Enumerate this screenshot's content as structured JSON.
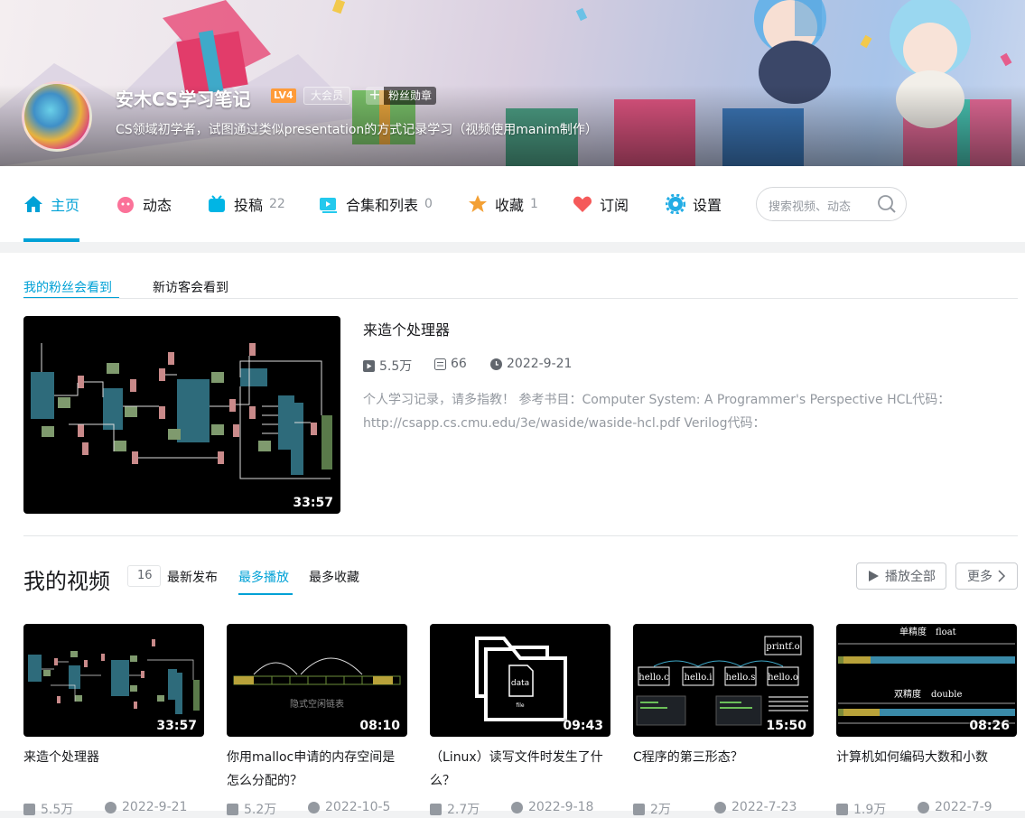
{
  "header": {
    "username": "安木CS学习笔记",
    "level": "LV4",
    "vip_label": "大会员",
    "fan_badge_plus": "+",
    "fan_badge_label": "粉丝勋章",
    "signature": "CS领域初学者，试图通过类似presentation的方式记录学习（视频使用manim制作）"
  },
  "nav": {
    "items": [
      {
        "label": "主页",
        "count": "",
        "icon": "home-icon",
        "color": "#00a1d6"
      },
      {
        "label": "动态",
        "count": "",
        "icon": "dynamic-icon",
        "color": "#fb7299"
      },
      {
        "label": "投稿",
        "count": "22",
        "icon": "upload-icon",
        "color": "#00b5e5"
      },
      {
        "label": "合集和列表",
        "count": "0",
        "icon": "collection-icon",
        "color": "#23c9ed"
      },
      {
        "label": "收藏",
        "count": "1",
        "icon": "favorite-icon",
        "color": "#f3a034"
      },
      {
        "label": "订阅",
        "count": "",
        "icon": "subscribe-icon",
        "color": "#f55a5a"
      },
      {
        "label": "设置",
        "count": "",
        "icon": "settings-icon",
        "color": "#23ade5"
      }
    ],
    "search_placeholder": "搜索视频、动态"
  },
  "visibility_tabs": [
    "我的粉丝会看到",
    "新访客会看到"
  ],
  "featured": {
    "title": "来造个处理器",
    "duration": "33:57",
    "plays": "5.5万",
    "comments": "66",
    "date": "2022-9-21",
    "description": "个人学习记录，请多指教！ 参考书目：Computer System: A Programmer's Perspective HCL代码：http://csapp.cs.cmu.edu/3e/waside/waside-hcl.pdf Verilog代码："
  },
  "videos_section": {
    "title": "我的视频",
    "count": "16",
    "sort_tabs": [
      "最新发布",
      "最多播放",
      "最多收藏"
    ],
    "active_sort": 1,
    "play_all_label": "播放全部",
    "more_label": "更多"
  },
  "videos": [
    {
      "title": "来造个处理器",
      "duration": "33:57",
      "plays": "5.5万",
      "date": "2022-9-21"
    },
    {
      "title": "你用malloc申请的内存空间是怎么分配的？",
      "duration": "08:10",
      "plays": "5.2万",
      "date": "2022-10-5",
      "thumb_text": "隐式空闲链表"
    },
    {
      "title": "（Linux）读写文件时发生了什么？",
      "duration": "09:43",
      "plays": "2.7万",
      "date": "2022-9-18",
      "thumb_text": "data",
      "thumb_subtext": "file"
    },
    {
      "title": "C程序的第三形态？",
      "duration": "15:50",
      "plays": "2万",
      "date": "2022-7-23",
      "thumb_labels": [
        "printf.o",
        "hello.c",
        "hello.i",
        "hello.s",
        "hello.o"
      ]
    },
    {
      "title": "计算机如何编码大数和小数",
      "duration": "08:26",
      "plays": "1.9万",
      "date": "2022-7-9",
      "thumb_labels": [
        "单精度",
        "float",
        "双精度",
        "double"
      ]
    }
  ]
}
